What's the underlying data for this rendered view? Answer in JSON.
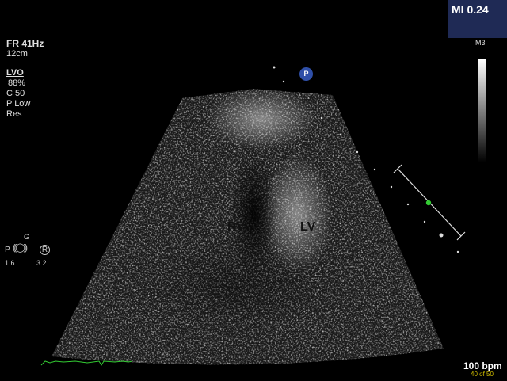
{
  "header": {
    "mechanical_index": "MI 0.24"
  },
  "settings": {
    "frame_rate": "FR 41Hz",
    "depth": "12cm",
    "mode": "LVO",
    "gain": "88%",
    "compression": "C 50",
    "frequency": "P Low",
    "resolution": "Res"
  },
  "grayscale_map": {
    "label": "M3"
  },
  "image": {
    "marker": "P",
    "labels": {
      "right_ventricle": "RV",
      "left_ventricle": "LV"
    }
  },
  "probe": {
    "g_label": "G",
    "p_label": "P",
    "r_label": "R",
    "left_value": "1.6",
    "right_value": "3.2"
  },
  "footer": {
    "heart_rate": "100 bpm",
    "frame_counter": "40 of 50"
  },
  "colors": {
    "mi_box": "#1f2a55",
    "probe_marker": "#2f4fa8",
    "ecg_trace": "#33cc33",
    "frame_counter": "#d4c000"
  }
}
